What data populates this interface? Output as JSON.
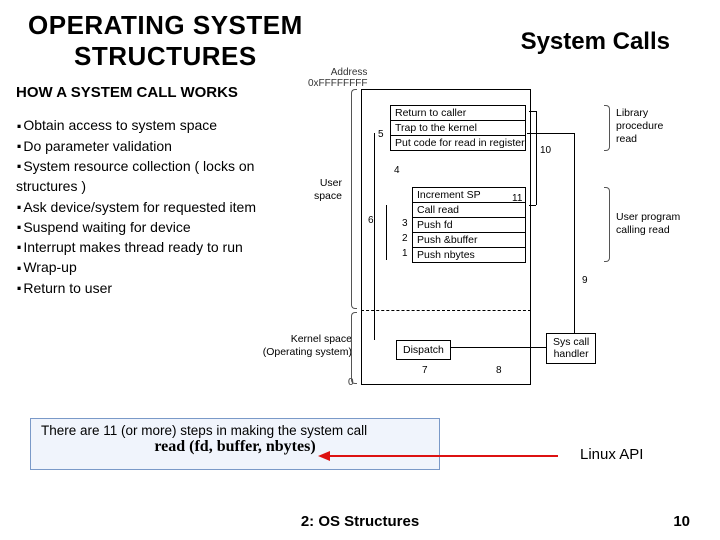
{
  "header": {
    "title_left_l1": "OPERATING SYSTEM",
    "title_left_l2": "STRUCTURES",
    "title_right": "System Calls"
  },
  "subheading": "HOW A SYSTEM CALL WORKS",
  "bullets": [
    "Obtain access to system space",
    "Do parameter validation",
    "System resource collection ( locks on structures )",
    "Ask device/system for requested item",
    "Suspend waiting for device",
    "Interrupt makes thread ready to run",
    "Wrap-up",
    "Return to user"
  ],
  "diagram": {
    "address_label_l1": "Address",
    "address_label_l2": "0xFFFFFFFF",
    "address_zero": "0",
    "lib_box": [
      "Return to caller",
      "Trap to the kernel",
      "Put code for read in register"
    ],
    "user_box": [
      "Increment SP",
      "Call read",
      "Push fd",
      "Push &buffer",
      "Push nbytes"
    ],
    "dispatch": "Dispatch",
    "syscall_handler_l1": "Sys call",
    "syscall_handler_l2": "handler",
    "side_lib_l1": "Library",
    "side_lib_l2": "procedure",
    "side_lib_l3": "read",
    "side_user_l1": "User program",
    "side_user_l2": "calling read",
    "region_user_l1": "User",
    "region_user_l2": "space",
    "region_kernel_l1": "Kernel space",
    "region_kernel_l2": "(Operating system)",
    "nums": {
      "n1": "1",
      "n2": "2",
      "n3": "3",
      "n4": "4",
      "n5": "5",
      "n6": "6",
      "n7": "7",
      "n8": "8",
      "n9": "9",
      "n10": "10",
      "n11": "11"
    }
  },
  "callout": {
    "line1": "There are 11 (or more) steps in making the system call",
    "line2": "read (fd, buffer, nbytes)"
  },
  "linux_api": "Linux API",
  "footer": "2: OS Structures",
  "page": "10"
}
